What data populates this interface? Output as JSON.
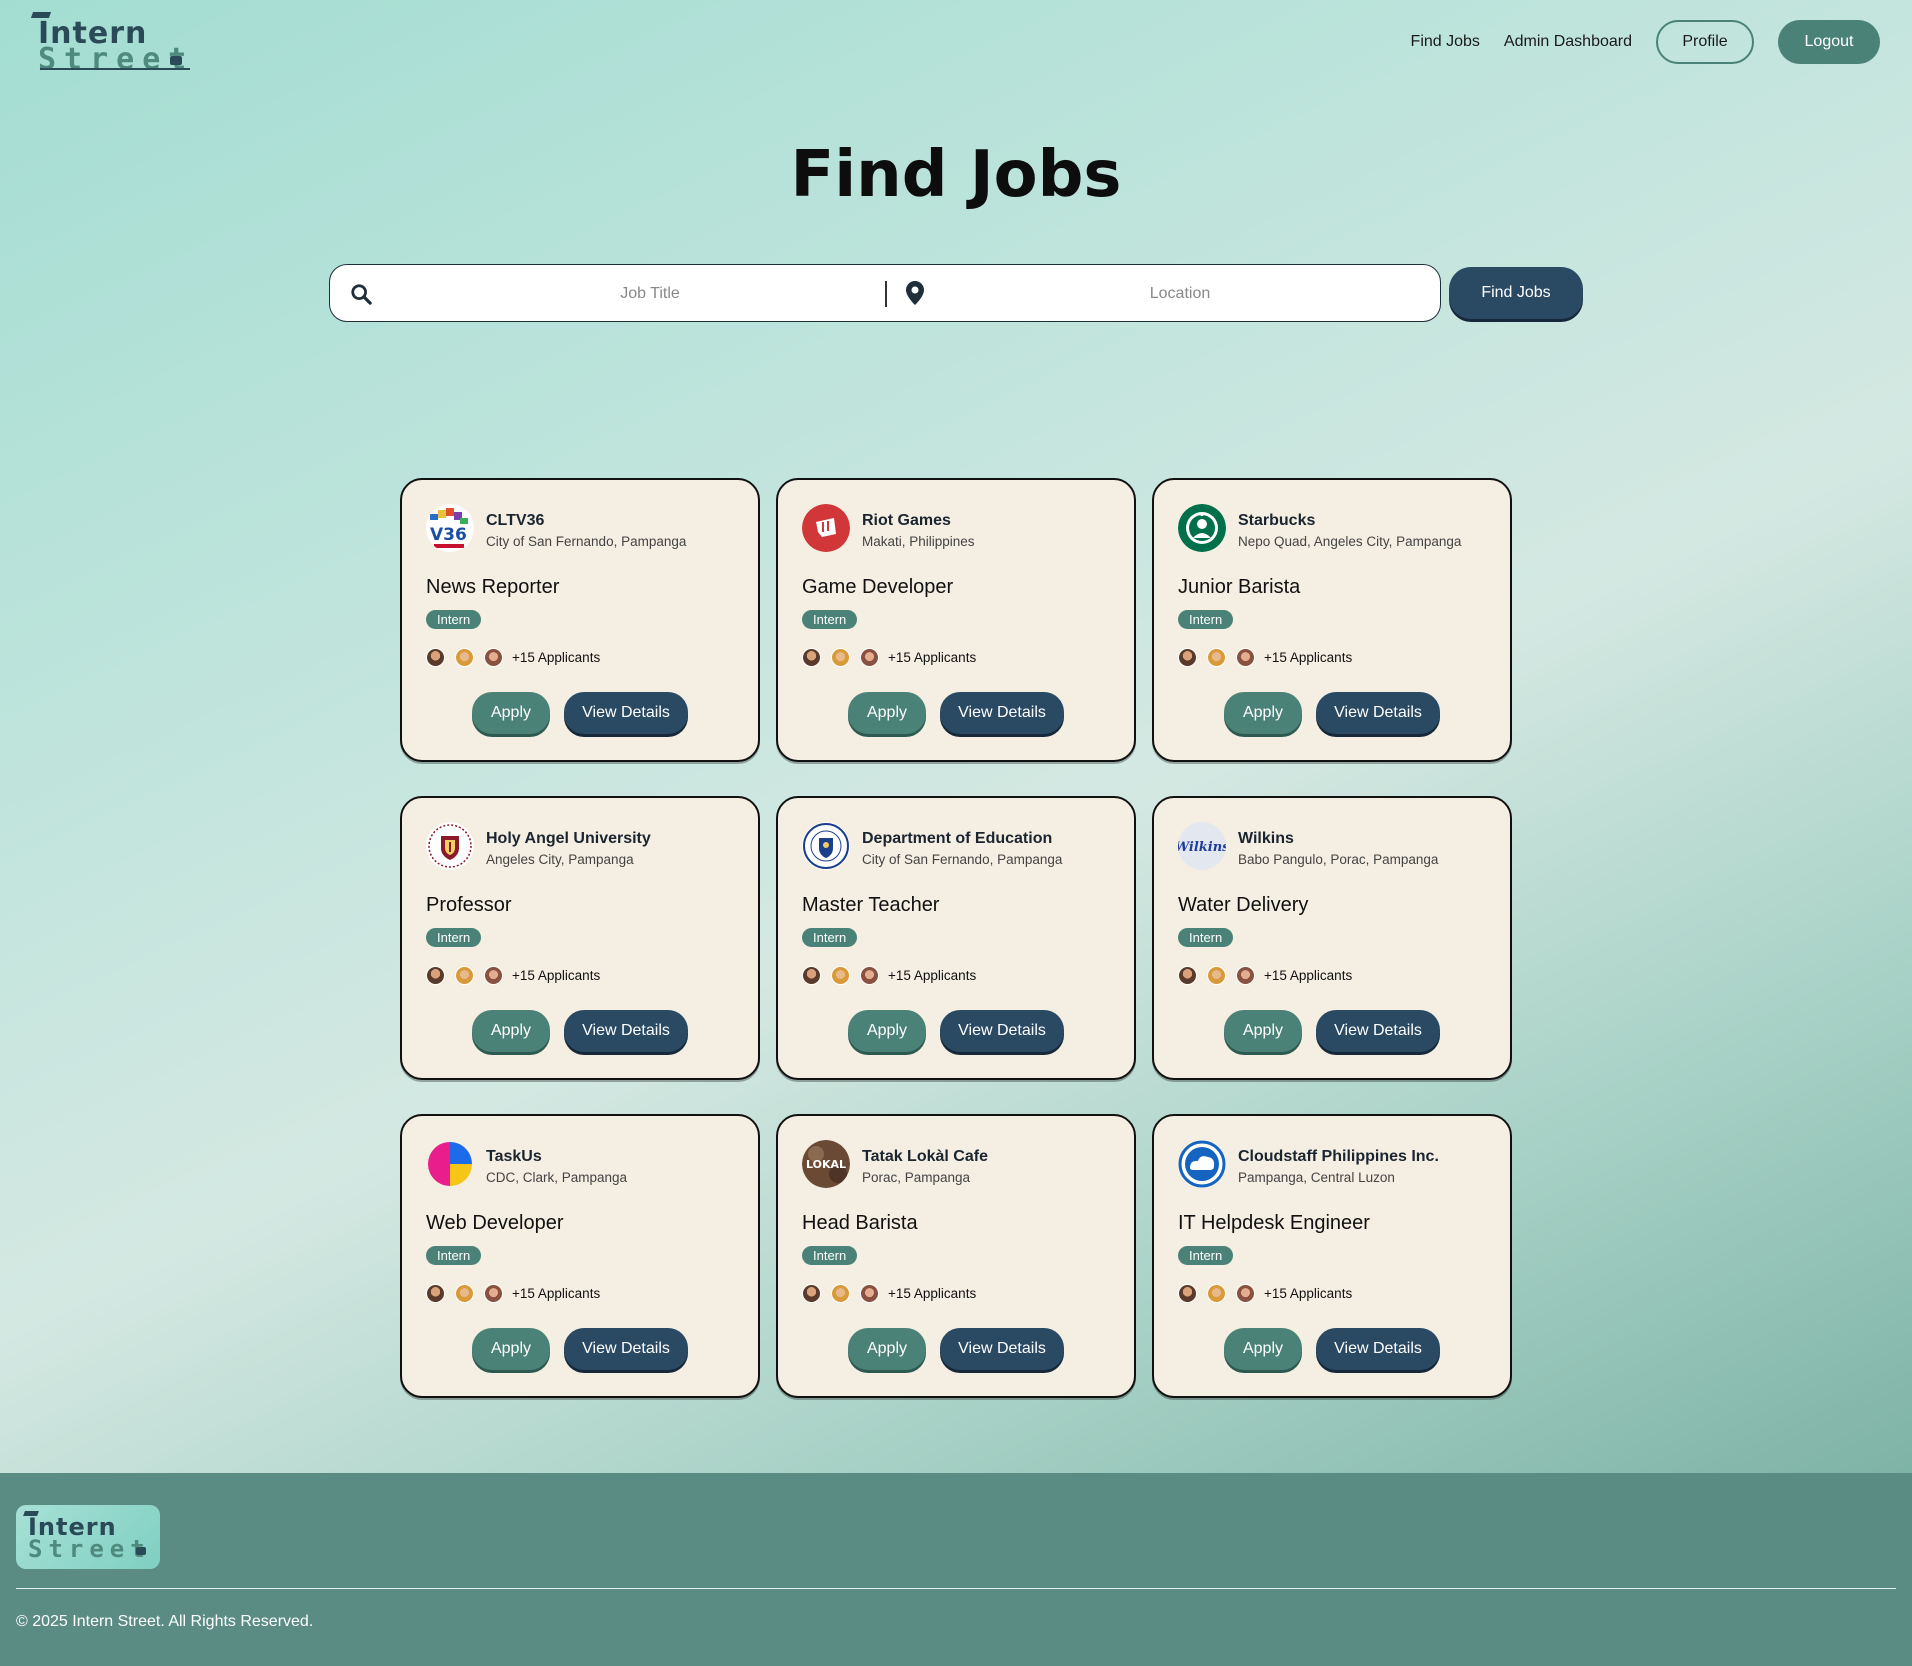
{
  "brand": {
    "line1": "Intern",
    "line2": "Street"
  },
  "nav": {
    "find_jobs": "Find Jobs",
    "admin": "Admin Dashboard",
    "profile": "Profile",
    "logout": "Logout"
  },
  "page": {
    "title": "Find Jobs"
  },
  "search": {
    "job_placeholder": "Job Title",
    "location_placeholder": "Location",
    "button": "Find Jobs"
  },
  "jobs": [
    {
      "company": "CLTV36",
      "location": "City of San Fernando, Pampanga",
      "title": "News Reporter",
      "type": "Intern",
      "applicants": "+15 Applicants",
      "logo_icon": "cltv36-logo",
      "apply": "Apply",
      "details": "View Details"
    },
    {
      "company": "Riot Games",
      "location": "Makati, Philippines",
      "title": "Game Developer",
      "type": "Intern",
      "applicants": "+15 Applicants",
      "logo_icon": "riot-games-logo",
      "apply": "Apply",
      "details": "View Details"
    },
    {
      "company": "Starbucks",
      "location": "Nepo Quad, Angeles City, Pampanga",
      "title": "Junior Barista",
      "type": "Intern",
      "applicants": "+15 Applicants",
      "logo_icon": "starbucks-logo",
      "apply": "Apply",
      "details": "View Details"
    },
    {
      "company": "Holy Angel University",
      "location": "Angeles City, Pampanga",
      "title": "Professor",
      "type": "Intern",
      "applicants": "+15 Applicants",
      "logo_icon": "hau-seal-logo",
      "apply": "Apply",
      "details": "View Details"
    },
    {
      "company": "Department of Education",
      "location": "City of San Fernando, Pampanga",
      "title": "Master Teacher",
      "type": "Intern",
      "applicants": "+15 Applicants",
      "logo_icon": "deped-seal-logo",
      "apply": "Apply",
      "details": "View Details"
    },
    {
      "company": "Wilkins",
      "location": "Babo Pangulo, Porac, Pampanga",
      "title": "Water Delivery",
      "type": "Intern",
      "applicants": "+15 Applicants",
      "logo_icon": "wilkins-logo",
      "apply": "Apply",
      "details": "View Details"
    },
    {
      "company": "TaskUs",
      "location": "CDC, Clark, Pampanga",
      "title": "Web Developer",
      "type": "Intern",
      "applicants": "+15 Applicants",
      "logo_icon": "taskus-logo",
      "apply": "Apply",
      "details": "View Details"
    },
    {
      "company": "Tatak Lokàl Cafe",
      "location": "Porac, Pampanga",
      "title": "Head Barista",
      "type": "Intern",
      "applicants": "+15 Applicants",
      "logo_icon": "lokal-logo",
      "apply": "Apply",
      "details": "View Details"
    },
    {
      "company": "Cloudstaff Philippines Inc.",
      "location": "Pampanga, Central Luzon",
      "title": "IT Helpdesk Engineer",
      "type": "Intern",
      "applicants": "+15 Applicants",
      "logo_icon": "cloudstaff-logo",
      "apply": "Apply",
      "details": "View Details"
    }
  ],
  "logo_text": {
    "cltv": "V36",
    "wilkins": "Wilkins",
    "lokal": "LOKAL"
  },
  "footer": {
    "copyright": "© 2025 Intern Street. All Rights Reserved."
  },
  "colors": {
    "primary_green": "#4a8277",
    "primary_navy": "#2a4a64",
    "card_bg": "#f5eee2",
    "footer_bg": "#5a8c84"
  }
}
